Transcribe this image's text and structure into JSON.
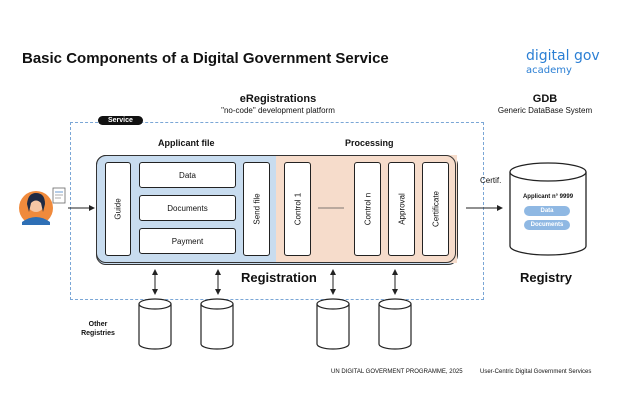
{
  "title": "Basic Components of a Digital Government Service",
  "brand": {
    "line1": "digital gov",
    "line2": "academy"
  },
  "ereg": {
    "title": "eRegistrations",
    "subtitle": "\"no-code\" development platform"
  },
  "gdb": {
    "title": "GDB",
    "subtitle": "Generic DataBase System"
  },
  "service_tag": "Service",
  "applicant_file": {
    "title": "Applicant file",
    "guide": "Guide",
    "fields": [
      "Data",
      "Documents",
      "Payment"
    ],
    "send_file": "Send file"
  },
  "processing": {
    "title": "Processing",
    "steps": [
      "Control  1",
      "Control  n",
      "Approval",
      "Certificate"
    ]
  },
  "registration_label": "Registration",
  "certif_label": "Certif.",
  "registry": {
    "label": "Registry",
    "record": "Applicant n° 9999",
    "pills": [
      "Data",
      "Documents"
    ]
  },
  "other_registries": "Other\nRegistries",
  "footer": {
    "left": "UN DIGITAL GOVERMENT PROGRAMME, 2025",
    "right": "User-Centric Digital Government Services"
  },
  "colors": {
    "applicant_bg": "#c8dcef",
    "processing_bg": "#f6dccb",
    "accent": "#2b7fd4",
    "pill": "#8fb8e3"
  }
}
